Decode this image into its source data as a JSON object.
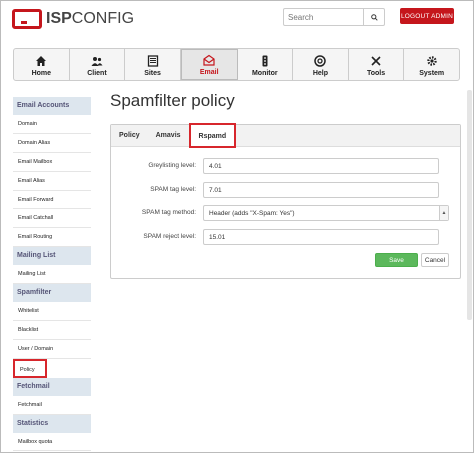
{
  "header": {
    "logo_text_bold": "ISP",
    "logo_text": "CONFIG",
    "search_placeholder": "Search",
    "logout_label": "LOGOUT ADMIN"
  },
  "nav": [
    {
      "label": "Home",
      "icon": "home-icon"
    },
    {
      "label": "Client",
      "icon": "client-icon"
    },
    {
      "label": "Sites",
      "icon": "sites-icon"
    },
    {
      "label": "Email",
      "icon": "email-icon",
      "active": true
    },
    {
      "label": "Monitor",
      "icon": "monitor-icon"
    },
    {
      "label": "Help",
      "icon": "help-icon"
    },
    {
      "label": "Tools",
      "icon": "tools-icon"
    },
    {
      "label": "System",
      "icon": "system-icon"
    }
  ],
  "sidebar": {
    "email_accounts": {
      "heading": "Email Accounts",
      "items": [
        "Domain",
        "Domain Alias",
        "Email Mailbox",
        "Email Alias",
        "Email Forward",
        "Email Catchall",
        "Email Routing"
      ]
    },
    "mailing_list": {
      "heading": "Mailing List",
      "items": [
        "Mailing List"
      ]
    },
    "spamfilter": {
      "heading": "Spamfilter",
      "items": [
        "Whitelist",
        "Blacklist",
        "User / Domain",
        "Policy"
      ]
    },
    "fetchmail": {
      "heading": "Fetchmail",
      "items": [
        "Fetchmail"
      ]
    },
    "statistics": {
      "heading": "Statistics",
      "items": [
        "Mailbox quota"
      ]
    }
  },
  "main": {
    "title": "Spamfilter policy",
    "tabs": [
      "Policy",
      "Amavis",
      "Rspamd"
    ],
    "fields": {
      "greylisting_label": "Greylisting level:",
      "greylisting_value": "4.01",
      "spam_tag_label": "SPAM tag level:",
      "spam_tag_value": "7.01",
      "spam_method_label": "SPAM tag method:",
      "spam_method_value": "Header (adds \"X-Spam: Yes\")",
      "spam_reject_label": "SPAM reject level:",
      "spam_reject_value": "15.01"
    },
    "save_label": "Save",
    "cancel_label": "Cancel"
  },
  "colors": {
    "brand_red": "#c5161c",
    "highlight_red": "#d7262c",
    "save_green": "#5cb85c",
    "sidebar_heading_bg": "#dde6ee"
  }
}
